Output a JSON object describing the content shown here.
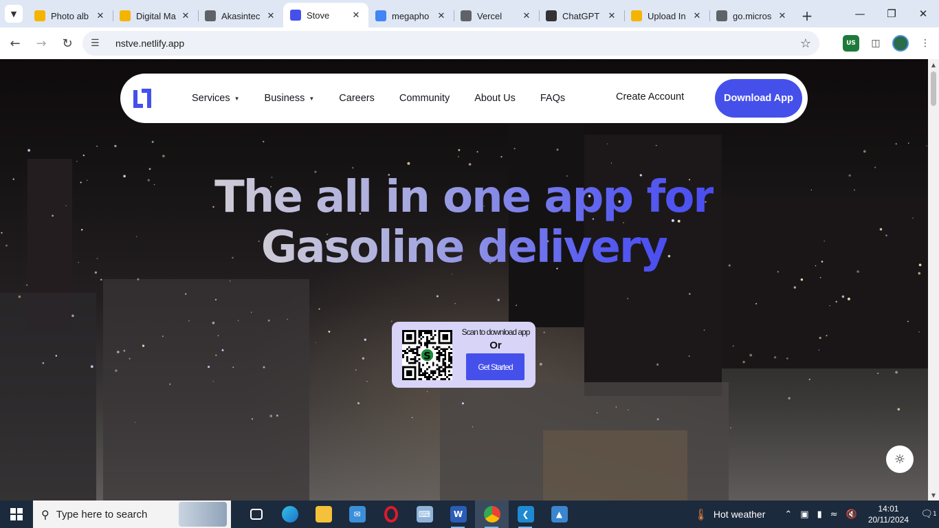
{
  "browser": {
    "tabs": [
      {
        "title": "Photo alb",
        "favicon": "slides-icon",
        "color": "#f5b400"
      },
      {
        "title": "Digital Ma",
        "favicon": "slides-icon",
        "color": "#f5b400"
      },
      {
        "title": "Akasintec",
        "favicon": "globe-icon",
        "color": "#5f6368"
      },
      {
        "title": "Stove",
        "favicon": "stove-logo-icon",
        "color": "#4550eb"
      },
      {
        "title": "megapho",
        "favicon": "google-icon",
        "color": "#4285f4"
      },
      {
        "title": "Vercel",
        "favicon": "globe-icon",
        "color": "#5f6368"
      },
      {
        "title": "ChatGPT",
        "favicon": "chatgpt-icon",
        "color": "#333333"
      },
      {
        "title": "Upload In",
        "favicon": "upload-icon",
        "color": "#f5b400"
      },
      {
        "title": "go.micros",
        "favicon": "globe-icon",
        "color": "#5f6368"
      }
    ],
    "active_tab": 3,
    "url": "nstve.netlify.app",
    "ext_vpn_label": "US"
  },
  "site": {
    "nav": {
      "services": "Services",
      "business": "Business",
      "careers": "Careers",
      "community": "Community",
      "about": "About Us",
      "faqs": "FAQs",
      "create_account": "Create Account",
      "download": "Download App"
    },
    "hero": {
      "line1": "The all in one app for",
      "line2": "Gasoline delivery"
    },
    "qr": {
      "scan": "Scan to download app",
      "or": "Or",
      "get_started": "Get Started"
    },
    "accent": "#4550eb"
  },
  "taskbar": {
    "search_placeholder": "Type here to search",
    "weather": "Hot weather",
    "time": "14:01",
    "date": "20/11/2024",
    "notification_count": "1"
  }
}
